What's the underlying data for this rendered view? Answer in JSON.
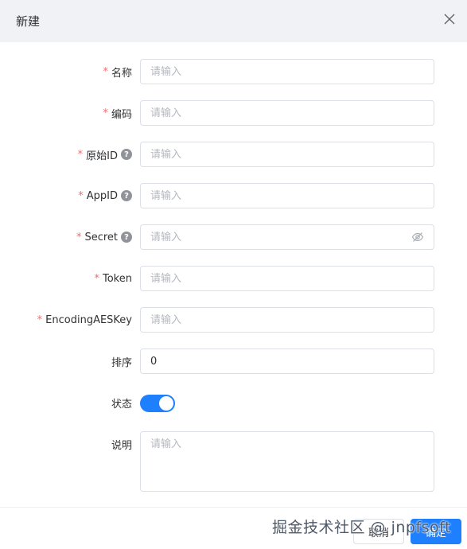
{
  "dialog": {
    "title": "新建"
  },
  "form": {
    "name": {
      "label": "名称",
      "required": "*",
      "placeholder": "请输入",
      "value": ""
    },
    "code": {
      "label": "编码",
      "required": "*",
      "placeholder": "请输入",
      "value": ""
    },
    "original_id": {
      "label": "原始ID",
      "required": "*",
      "placeholder": "请输入",
      "value": "",
      "help": "?"
    },
    "app_id": {
      "label": "AppID",
      "required": "*",
      "placeholder": "请输入",
      "value": "",
      "help": "?"
    },
    "secret": {
      "label": "Secret",
      "required": "*",
      "placeholder": "请输入",
      "value": "",
      "help": "?",
      "icon": "eye-off-icon"
    },
    "token": {
      "label": "Token",
      "required": "*",
      "placeholder": "请输入",
      "value": ""
    },
    "encoding_aes_key": {
      "label": "EncodingAESKey",
      "required": "*",
      "placeholder": "请输入",
      "value": ""
    },
    "sort": {
      "label": "排序",
      "placeholder": "请输入",
      "value": "0"
    },
    "status": {
      "label": "状态",
      "enabled": true
    },
    "description": {
      "label": "说明",
      "placeholder": "请输入",
      "value": ""
    }
  },
  "footer": {
    "cancel_label": "取消",
    "ok_label": "确定"
  },
  "watermark": "掘金技术社区 @ jnpfsoft",
  "colors": {
    "accent": "#1e80ff",
    "required": "#f56c6c",
    "header_bg": "#f0f2f5"
  }
}
